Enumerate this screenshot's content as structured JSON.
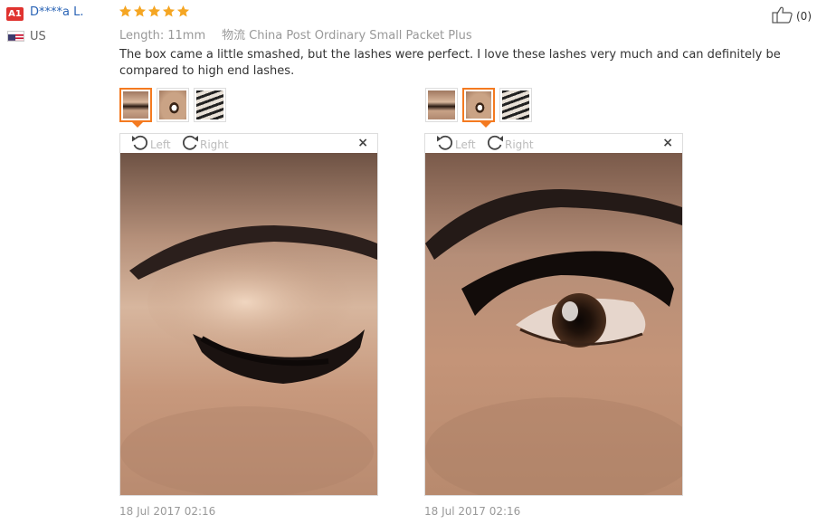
{
  "reviewer": {
    "level": "A1",
    "name": "D****a L.",
    "country": "US"
  },
  "rating": {
    "stars": 5,
    "max": 5,
    "color": "#f5a623"
  },
  "helpful": {
    "count": "(0)"
  },
  "meta": {
    "length_label": "Length:",
    "length_value": "11mm",
    "shipping_label": "物流",
    "shipping_value": "China Post Ordinary Small Packet Plus"
  },
  "review_text": "The box came a little smashed, but the lashes were perfect. I love these lashes very much and can definitely be compared to high end lashes.",
  "viewers": [
    {
      "active_thumb": 0,
      "rotate_left": "Left",
      "rotate_right": "Right",
      "close": "×",
      "photo_icon": "closed-eye-photo",
      "date": "18 Jul 2017 02:16"
    },
    {
      "active_thumb": 1,
      "rotate_left": "Left",
      "rotate_right": "Right",
      "close": "×",
      "photo_icon": "open-eye-photo",
      "date": "18 Jul 2017 02:16"
    }
  ],
  "colors": {
    "accent": "#f47a20",
    "link": "#2a64b6",
    "badge": "#e0332f"
  }
}
